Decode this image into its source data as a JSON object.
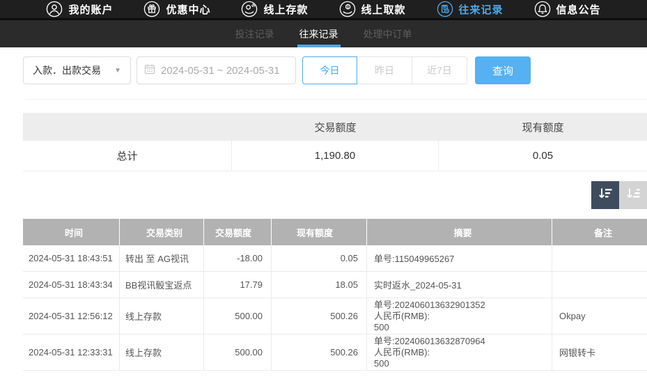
{
  "accent_color": "#4fa8ea",
  "search_button_color": "#55b1f1",
  "topnav": {
    "items": [
      {
        "label": "我的账户",
        "icon": "user-icon",
        "active": false
      },
      {
        "label": "优惠中心",
        "icon": "gift-icon",
        "active": false
      },
      {
        "label": "线上存款",
        "icon": "deposit-icon",
        "active": false
      },
      {
        "label": "线上取款",
        "icon": "withdraw-icon",
        "active": false
      },
      {
        "label": "往来记录",
        "icon": "records-icon",
        "active": true
      },
      {
        "label": "信息公告",
        "icon": "announcement-icon",
        "active": false
      }
    ]
  },
  "tabs": {
    "items": [
      {
        "label": "投注记录",
        "active": false
      },
      {
        "label": "往来记录",
        "active": true
      },
      {
        "label": "处理中订单",
        "active": false
      }
    ]
  },
  "filters": {
    "type_select_value": "入款．出款交易",
    "date_range": "2024-05-31 ~ 2024-05-31",
    "quick_buttons": [
      {
        "label": "今日",
        "active": true
      },
      {
        "label": "昨日",
        "active": false
      },
      {
        "label": "近7日",
        "active": false
      }
    ],
    "search_button": "查询"
  },
  "summary_table": {
    "headers": [
      "",
      "交易额度",
      "现有额度"
    ],
    "total_row": {
      "label": "总计",
      "amount": "1,190.80",
      "balance": "0.05"
    }
  },
  "main_table": {
    "headers": [
      "时间",
      "交易类别",
      "交易额度",
      "现有额度",
      "摘要",
      "备注"
    ],
    "rows": [
      {
        "time": "2024-05-31 18:43:51",
        "type": "转出 至 AG视讯",
        "amount": "-18.00",
        "balance": "0.05",
        "summary": [
          "单号:115049965267"
        ],
        "remark": ""
      },
      {
        "time": "2024-05-31 18:43:34",
        "type": "BB视讯骰宝返点",
        "amount": "17.79",
        "balance": "18.05",
        "summary": [
          "实时返水_2024-05-31"
        ],
        "remark": ""
      },
      {
        "time": "2024-05-31 12:56:12",
        "type": "线上存款",
        "amount": "500.00",
        "balance": "500.26",
        "summary": [
          "单号:202406013632901352",
          "人民币(RMB):",
          "500"
        ],
        "remark": "Okpay"
      },
      {
        "time": "2024-05-31 12:33:31",
        "type": "线上存款",
        "amount": "500.00",
        "balance": "500.26",
        "summary": [
          "单号:202406013632870964",
          "人民币(RMB):",
          "500"
        ],
        "remark": "网银转卡"
      }
    ]
  }
}
